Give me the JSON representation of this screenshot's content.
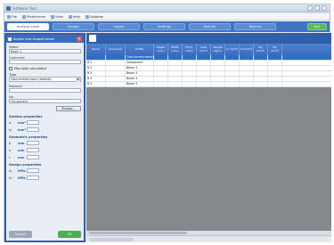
{
  "window": {
    "title": "Software Tool"
  },
  "menu": [
    {
      "icon": "file-icon",
      "label": "File"
    },
    {
      "icon": "preferences-icon",
      "label": "Preferences"
    },
    {
      "icon": "view-icon",
      "label": "View"
    },
    {
      "icon": "help-icon",
      "label": "Help"
    },
    {
      "icon": "update-icon",
      "label": "Updates"
    }
  ],
  "tabs": [
    {
      "label": "Analysis Level",
      "active": true
    },
    {
      "label": "Design",
      "active": false
    },
    {
      "label": "Import",
      "active": false
    },
    {
      "label": "Settings",
      "active": false
    },
    {
      "label": "Results",
      "active": false
    },
    {
      "label": "Reports",
      "active": false
    }
  ],
  "tab_action_label": "Run",
  "side_panel": {
    "title": "Import new shaped beam",
    "name_label": "Name",
    "name_value": "Beam 1",
    "comment_label": "Comment",
    "comment_value": "",
    "checkbox_label": "Manually calculated",
    "type_label": "Type",
    "type_value": "Cold-formed beam (default)",
    "material_label": "Material",
    "profile_label": "No",
    "profile_value": "Component",
    "browse_label": "Browse...",
    "section_properties": "Section properties",
    "props": [
      {
        "label": "A",
        "value": "",
        "unit": "mm²"
      },
      {
        "label": "Iy",
        "value": "",
        "unit": "mm⁴"
      }
    ],
    "section_geometry": "Geometric properties",
    "geom": [
      {
        "label": "b",
        "value": "",
        "unit": "mm"
      },
      {
        "label": "h",
        "value": "",
        "unit": "mm"
      },
      {
        "label": "t",
        "value": "",
        "unit": "mm"
      }
    ],
    "section_design": "Design properties",
    "design": [
      {
        "label": "fy",
        "value": "",
        "unit": "MPa"
      },
      {
        "label": "fu",
        "value": "",
        "unit": "MPa"
      }
    ],
    "cancel_label": "Cancel",
    "apply_label": "OK"
  },
  "grid": {
    "columns": [
      "Name",
      "Comment",
      "Profile",
      "Height (mm)",
      "Width (mm)",
      "Thick. (mm)",
      "Area (mm²)",
      "Weight (kg/m)",
      "Iy (mm⁴)",
      "Iz (mm⁴)",
      "Wy (mm³)",
      "Wz (mm³)"
    ],
    "rows": [
      {
        "selected": true,
        "cells": [
          "",
          "",
          "Cold-formed beam",
          "",
          "",
          "",
          "",
          "",
          "",
          "",
          "",
          ""
        ]
      },
      {
        "selected": false,
        "cells": [
          "B 1",
          "",
          "Component",
          "",
          "",
          "",
          "",
          "",
          "",
          "",
          "",
          ""
        ]
      },
      {
        "selected": false,
        "cells": [
          "B 2",
          "",
          "Beam 2",
          "",
          "",
          "",
          "",
          "",
          "",
          "",
          "",
          ""
        ]
      },
      {
        "selected": false,
        "cells": [
          "B 3",
          "",
          "Beam 3",
          "",
          "",
          "",
          "",
          "",
          "",
          "",
          "",
          ""
        ]
      },
      {
        "selected": false,
        "cells": [
          "B 4",
          "",
          "Beam 4",
          "",
          "",
          "",
          "",
          "",
          "",
          "",
          "",
          ""
        ]
      },
      {
        "selected": false,
        "cells": [
          "B 5",
          "",
          "Beam 5",
          "",
          "",
          "",
          "",
          "",
          "",
          "",
          "",
          ""
        ]
      }
    ]
  },
  "status": {
    "progress": 0.45
  },
  "colors": {
    "accent": "#3a6cc0",
    "selection": "#2f6cc6",
    "run": "#5cb85c"
  }
}
